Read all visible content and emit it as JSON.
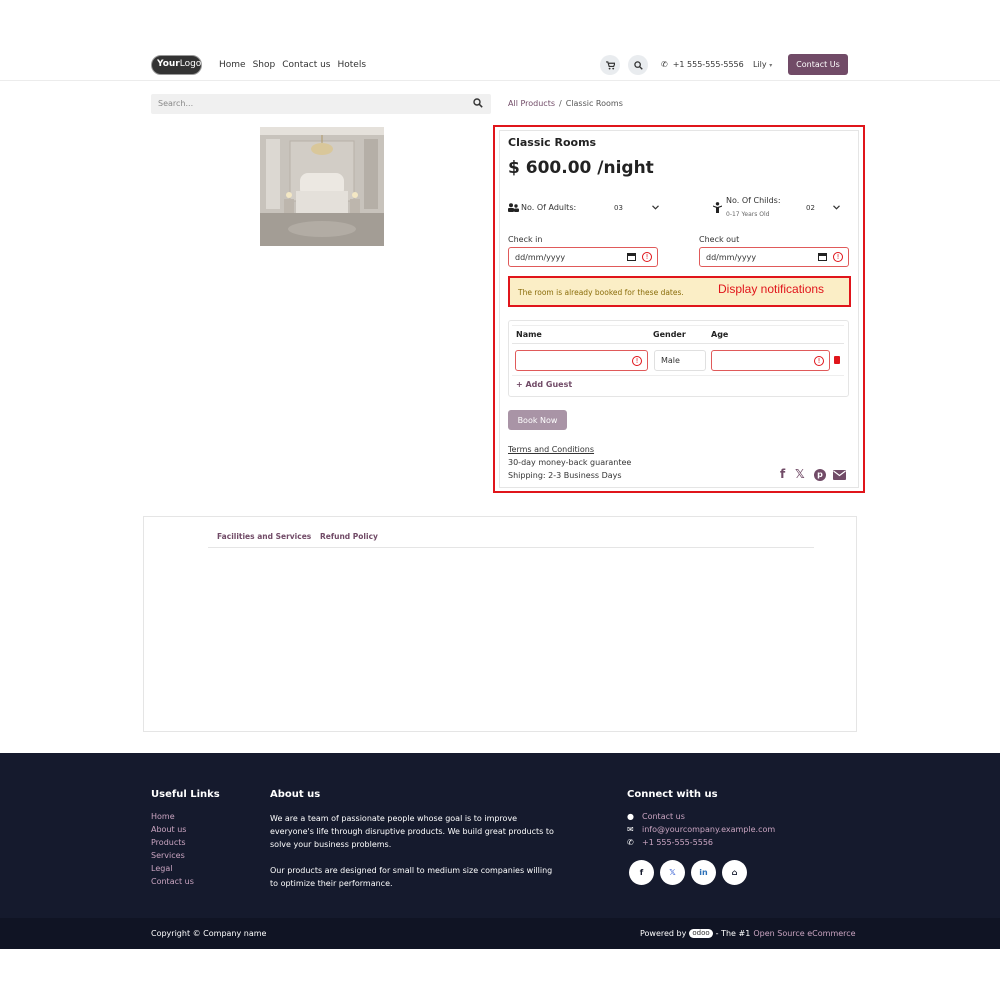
{
  "header": {
    "logo_your": "Your",
    "logo_logo": "Logo",
    "nav": [
      "Home",
      "Shop",
      "Contact us",
      "Hotels"
    ],
    "phone": "+1 555-555-5556",
    "user": "Lily",
    "contact_button": "Contact Us"
  },
  "search": {
    "placeholder": "Search..."
  },
  "breadcrumb": {
    "parent": "All Products",
    "separator": "/",
    "current": "Classic Rooms"
  },
  "product": {
    "title": "Classic Rooms",
    "price": "$ 600.00 /night",
    "adults_label": "No. Of Adults:",
    "adults_value": "03",
    "childs_label": "No. Of Childs:",
    "childs_sub": "0-17 Years Old",
    "childs_value": "02",
    "checkin_label": "Check in",
    "checkin_placeholder": "dd/mm/yyyy",
    "checkout_label": "Check out",
    "checkout_placeholder": "dd/mm/yyyy",
    "alert_message": "The room is already booked for these dates.",
    "annotation": "Display notifications",
    "guest_headers": {
      "name": "Name",
      "gender": "Gender",
      "age": "Age"
    },
    "guest_gender": "Male",
    "add_guest": "+ Add Guest",
    "book_now": "Book Now",
    "terms": "Terms and Conditions",
    "guarantee": "30-day money-back guarantee",
    "shipping": "Shipping: 2-3 Business Days"
  },
  "tabs": [
    "Facilities and Services",
    "Refund Policy"
  ],
  "footer": {
    "useful_links_title": "Useful Links",
    "useful_links": [
      "Home",
      "About us",
      "Products",
      "Services",
      "Legal",
      "Contact us"
    ],
    "about_title": "About us",
    "about_p1": "We are a team of passionate people whose goal is to improve everyone's life through disruptive products. We build great products to solve your business problems.",
    "about_p2": "Our products are designed for small to medium size companies willing to optimize their performance.",
    "connect_title": "Connect with us",
    "connect_contact": "Contact us",
    "connect_email": "info@yourcompany.example.com",
    "connect_phone": "+1 555-555-5556",
    "copyright": "Copyright © Company name",
    "powered_by": "Powered by",
    "odoo": "odoo",
    "the_first": "- The #1",
    "ecommerce": "Open Source eCommerce"
  },
  "colors": {
    "brand": "#714b67",
    "highlight": "#e0151b",
    "footer_bg": "#151a2d"
  }
}
